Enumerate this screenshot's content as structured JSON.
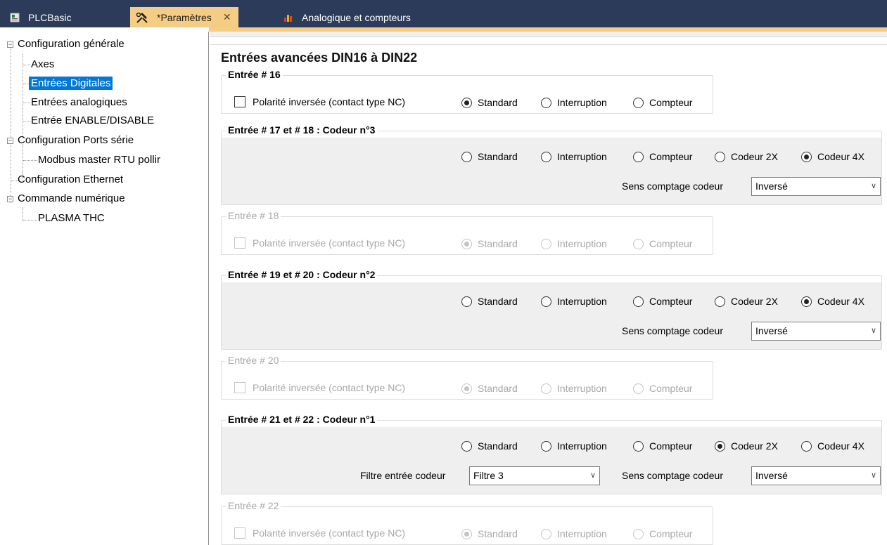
{
  "tabs": [
    {
      "label": "PLCBasic",
      "icon": "plc-file-icon"
    },
    {
      "label": "*Paramètres",
      "icon": "tools-icon",
      "close": "✕"
    },
    {
      "label": "Analogique et compteurs",
      "icon": "chart-icon"
    }
  ],
  "tree": {
    "items": [
      {
        "label": "Configuration générale",
        "expander": "⊟"
      },
      {
        "label": "Axes"
      },
      {
        "label": "Entrées Digitales"
      },
      {
        "label": "Entrées analogiques"
      },
      {
        "label": "Entrée ENABLE/DISABLE"
      },
      {
        "label": "Configuration Ports série",
        "expander": "⊟"
      },
      {
        "label": "Modbus master RTU pollir"
      },
      {
        "label": "Configuration Ethernet"
      },
      {
        "label": "Commande numérique",
        "expander": "⊟"
      },
      {
        "label": "PLASMA THC"
      }
    ]
  },
  "panel": {
    "title": "Entrées avancées DIN16 à DIN22"
  },
  "groups": {
    "in16": {
      "legend": "Entrée # 16",
      "checkbox": "Polarité inversée (contact type NC)",
      "opt_standard": "Standard",
      "opt_interruption": "Interruption",
      "opt_compteur": "Compteur"
    },
    "in17": {
      "legend": "Entrée # 17 et # 18 : Codeur n°3",
      "opt_standard": "Standard",
      "opt_interruption": "Interruption",
      "opt_compteur": "Compteur",
      "opt_codeur2x": "Codeur 2X",
      "opt_codeur4x": "Codeur 4X",
      "sens_label": "Sens comptage codeur",
      "sens_value": "Inversé"
    },
    "in18": {
      "legend": "Entrée # 18",
      "checkbox": "Polarité inversée (contact type NC)",
      "opt_standard": "Standard",
      "opt_interruption": "Interruption",
      "opt_compteur": "Compteur"
    },
    "in19": {
      "legend": "Entrée # 19 et # 20 : Codeur n°2",
      "opt_standard": "Standard",
      "opt_interruption": "Interruption",
      "opt_compteur": "Compteur",
      "opt_codeur2x": "Codeur 2X",
      "opt_codeur4x": "Codeur 4X",
      "sens_label": "Sens comptage codeur",
      "sens_value": "Inversé"
    },
    "in20": {
      "legend": "Entrée # 20",
      "checkbox": "Polarité inversée (contact type NC)",
      "opt_standard": "Standard",
      "opt_interruption": "Interruption",
      "opt_compteur": "Compteur"
    },
    "in21": {
      "legend": "Entrée # 21 et # 22 : Codeur n°1",
      "opt_standard": "Standard",
      "opt_interruption": "Interruption",
      "opt_compteur": "Compteur",
      "opt_codeur2x": "Codeur 2X",
      "opt_codeur4x": "Codeur 4X",
      "filtre_label": "Filtre entrée codeur",
      "filtre_value": "Filtre 3",
      "sens_label": "Sens comptage codeur",
      "sens_value": "Inversé"
    },
    "in22": {
      "legend": "Entrée # 22",
      "checkbox": "Polarité inversée (contact type NC)",
      "opt_standard": "Standard",
      "opt_interruption": "Interruption",
      "opt_compteur": "Compteur"
    }
  },
  "colors": {
    "tabbar": "#2b3b59",
    "active_tab": "#f5cc84",
    "selection": "#0078d7"
  }
}
